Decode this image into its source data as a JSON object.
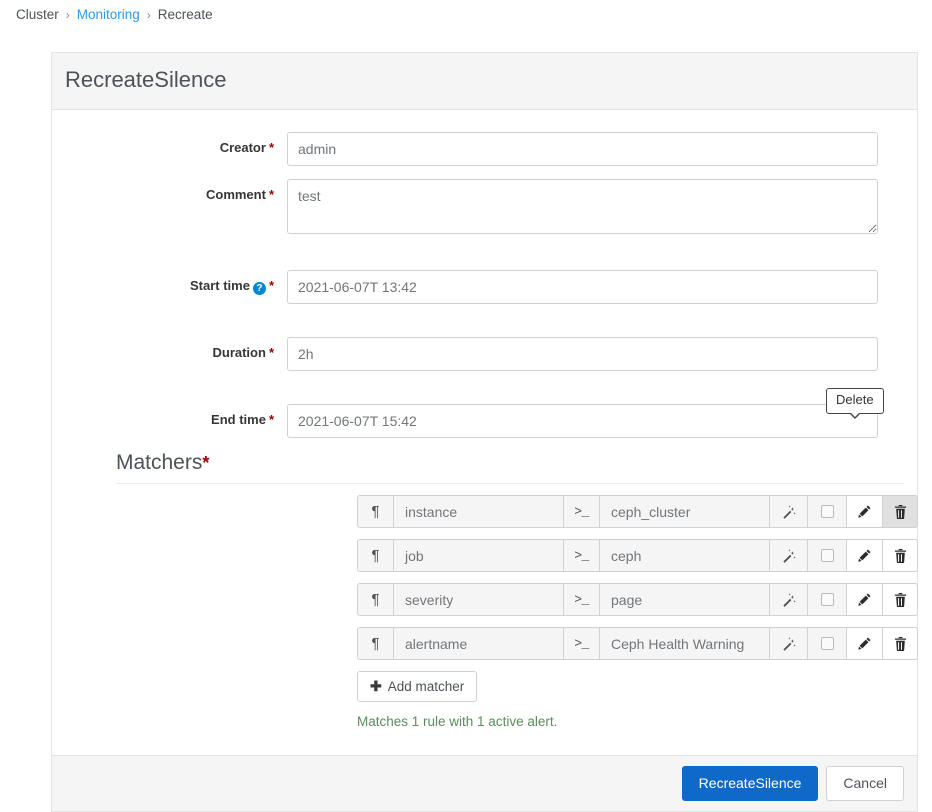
{
  "breadcrumb": {
    "items": [
      {
        "label": "Cluster",
        "link": false
      },
      {
        "label": "Monitoring",
        "link": true
      },
      {
        "label": "Recreate",
        "link": false
      }
    ],
    "separator": "›"
  },
  "card": {
    "title": "RecreateSilence"
  },
  "form": {
    "creator": {
      "label": "Creator",
      "required_mark": "*",
      "value": "admin"
    },
    "comment": {
      "label": "Comment",
      "required_mark": "*",
      "value": "test"
    },
    "start_time": {
      "label": "Start time",
      "required_mark": "*",
      "help_icon": "help-circle-icon",
      "help_glyph": "?",
      "value": "2021-06-07T 13:42"
    },
    "duration": {
      "label": "Duration",
      "required_mark": "*",
      "value": "2h"
    },
    "end_time": {
      "label": "End time",
      "required_mark": "*",
      "value": "2021-06-07T 15:42"
    }
  },
  "matchers": {
    "heading": "Matchers",
    "required_mark": "*",
    "pilcrow_glyph": "¶",
    "terminal_glyph": ">_",
    "rows": [
      {
        "name": "instance",
        "value": "ceph_cluster"
      },
      {
        "name": "job",
        "value": "ceph"
      },
      {
        "name": "severity",
        "value": "page"
      },
      {
        "name": "alertname",
        "value": "Ceph Health Warning"
      }
    ],
    "add_button": {
      "label": "Add matcher",
      "plus_glyph": "✚"
    },
    "note": "Matches 1 rule with 1 active alert.",
    "note_color": "#5a8d5a"
  },
  "tooltip": {
    "label": "Delete",
    "target_row_index": 0
  },
  "footer": {
    "submit_label": "RecreateSilence",
    "cancel_label": "Cancel"
  },
  "colors": {
    "primary": "#0f69c9",
    "link": "#2b9af3",
    "required": "#a30000",
    "help": "#0088ce"
  }
}
